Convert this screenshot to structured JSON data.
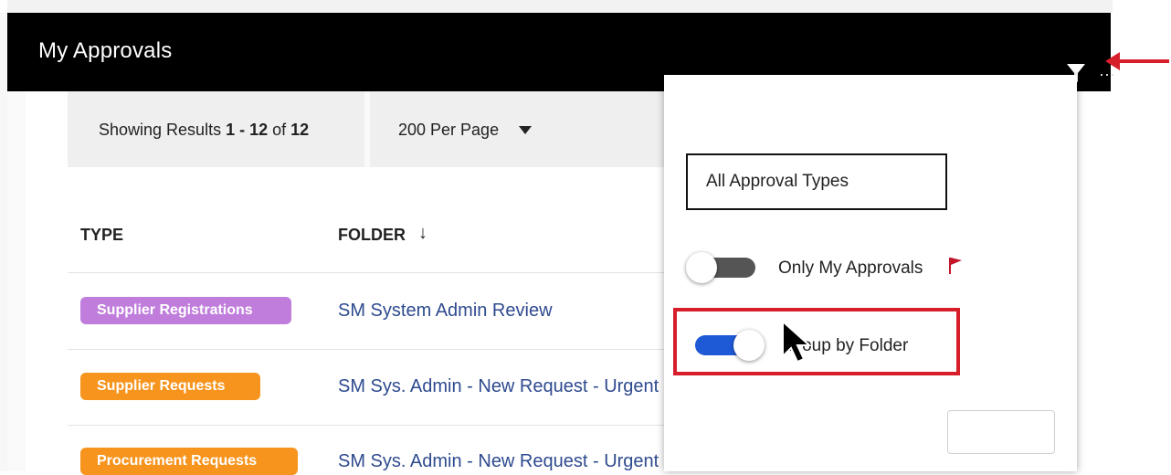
{
  "header": {
    "title": "My Approvals"
  },
  "results": {
    "prefix": "Showing Results ",
    "range": "1 - 12",
    "of": " of ",
    "total": "12",
    "per_page": "200 Per Page"
  },
  "table": {
    "columns": [
      "TYPE",
      "FOLDER"
    ],
    "rows": [
      {
        "type": "Supplier Registrations",
        "type_color": "#c07ddc",
        "folder": "SM System Admin Review"
      },
      {
        "type": "Supplier Requests",
        "type_color": "#f7941d",
        "folder": "SM Sys. Admin - New Request - Urgent"
      },
      {
        "type": "Procurement Requests",
        "type_color": "#f7941d",
        "folder": "SM Sys. Admin - New Request - Urgent"
      }
    ]
  },
  "filter_panel": {
    "approval_type": "All Approval Types",
    "only_my_approvals": {
      "label": "Only My Approvals",
      "on": false
    },
    "group_by_folder": {
      "label": "Group by Folder",
      "on": true
    }
  },
  "colors": {
    "accent_toggle": "#1e5ad6",
    "highlight": "#d61f2b",
    "link": "#2e4a8f"
  }
}
